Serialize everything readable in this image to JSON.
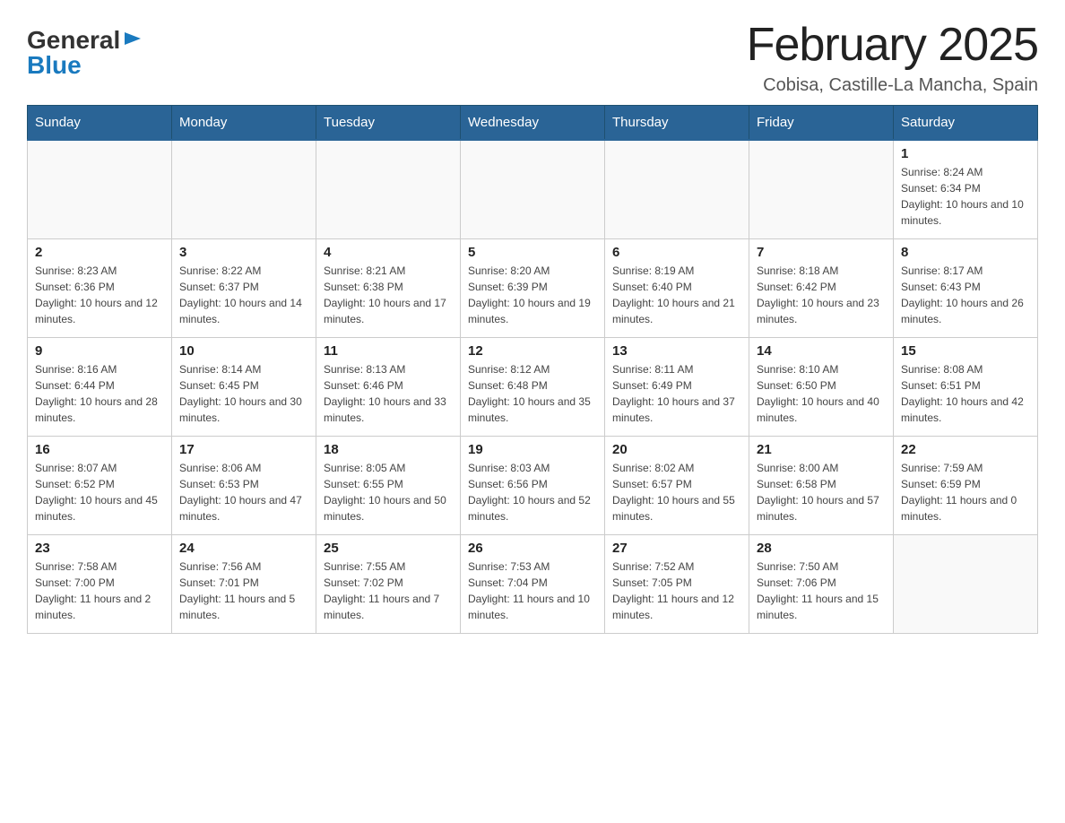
{
  "logo": {
    "general": "General",
    "blue": "Blue",
    "arrow_symbol": "▶"
  },
  "title": "February 2025",
  "subtitle": "Cobisa, Castille-La Mancha, Spain",
  "days_of_week": [
    "Sunday",
    "Monday",
    "Tuesday",
    "Wednesday",
    "Thursday",
    "Friday",
    "Saturday"
  ],
  "weeks": [
    [
      {
        "day": "",
        "info": ""
      },
      {
        "day": "",
        "info": ""
      },
      {
        "day": "",
        "info": ""
      },
      {
        "day": "",
        "info": ""
      },
      {
        "day": "",
        "info": ""
      },
      {
        "day": "",
        "info": ""
      },
      {
        "day": "1",
        "info": "Sunrise: 8:24 AM\nSunset: 6:34 PM\nDaylight: 10 hours and 10 minutes."
      }
    ],
    [
      {
        "day": "2",
        "info": "Sunrise: 8:23 AM\nSunset: 6:36 PM\nDaylight: 10 hours and 12 minutes."
      },
      {
        "day": "3",
        "info": "Sunrise: 8:22 AM\nSunset: 6:37 PM\nDaylight: 10 hours and 14 minutes."
      },
      {
        "day": "4",
        "info": "Sunrise: 8:21 AM\nSunset: 6:38 PM\nDaylight: 10 hours and 17 minutes."
      },
      {
        "day": "5",
        "info": "Sunrise: 8:20 AM\nSunset: 6:39 PM\nDaylight: 10 hours and 19 minutes."
      },
      {
        "day": "6",
        "info": "Sunrise: 8:19 AM\nSunset: 6:40 PM\nDaylight: 10 hours and 21 minutes."
      },
      {
        "day": "7",
        "info": "Sunrise: 8:18 AM\nSunset: 6:42 PM\nDaylight: 10 hours and 23 minutes."
      },
      {
        "day": "8",
        "info": "Sunrise: 8:17 AM\nSunset: 6:43 PM\nDaylight: 10 hours and 26 minutes."
      }
    ],
    [
      {
        "day": "9",
        "info": "Sunrise: 8:16 AM\nSunset: 6:44 PM\nDaylight: 10 hours and 28 minutes."
      },
      {
        "day": "10",
        "info": "Sunrise: 8:14 AM\nSunset: 6:45 PM\nDaylight: 10 hours and 30 minutes."
      },
      {
        "day": "11",
        "info": "Sunrise: 8:13 AM\nSunset: 6:46 PM\nDaylight: 10 hours and 33 minutes."
      },
      {
        "day": "12",
        "info": "Sunrise: 8:12 AM\nSunset: 6:48 PM\nDaylight: 10 hours and 35 minutes."
      },
      {
        "day": "13",
        "info": "Sunrise: 8:11 AM\nSunset: 6:49 PM\nDaylight: 10 hours and 37 minutes."
      },
      {
        "day": "14",
        "info": "Sunrise: 8:10 AM\nSunset: 6:50 PM\nDaylight: 10 hours and 40 minutes."
      },
      {
        "day": "15",
        "info": "Sunrise: 8:08 AM\nSunset: 6:51 PM\nDaylight: 10 hours and 42 minutes."
      }
    ],
    [
      {
        "day": "16",
        "info": "Sunrise: 8:07 AM\nSunset: 6:52 PM\nDaylight: 10 hours and 45 minutes."
      },
      {
        "day": "17",
        "info": "Sunrise: 8:06 AM\nSunset: 6:53 PM\nDaylight: 10 hours and 47 minutes."
      },
      {
        "day": "18",
        "info": "Sunrise: 8:05 AM\nSunset: 6:55 PM\nDaylight: 10 hours and 50 minutes."
      },
      {
        "day": "19",
        "info": "Sunrise: 8:03 AM\nSunset: 6:56 PM\nDaylight: 10 hours and 52 minutes."
      },
      {
        "day": "20",
        "info": "Sunrise: 8:02 AM\nSunset: 6:57 PM\nDaylight: 10 hours and 55 minutes."
      },
      {
        "day": "21",
        "info": "Sunrise: 8:00 AM\nSunset: 6:58 PM\nDaylight: 10 hours and 57 minutes."
      },
      {
        "day": "22",
        "info": "Sunrise: 7:59 AM\nSunset: 6:59 PM\nDaylight: 11 hours and 0 minutes."
      }
    ],
    [
      {
        "day": "23",
        "info": "Sunrise: 7:58 AM\nSunset: 7:00 PM\nDaylight: 11 hours and 2 minutes."
      },
      {
        "day": "24",
        "info": "Sunrise: 7:56 AM\nSunset: 7:01 PM\nDaylight: 11 hours and 5 minutes."
      },
      {
        "day": "25",
        "info": "Sunrise: 7:55 AM\nSunset: 7:02 PM\nDaylight: 11 hours and 7 minutes."
      },
      {
        "day": "26",
        "info": "Sunrise: 7:53 AM\nSunset: 7:04 PM\nDaylight: 11 hours and 10 minutes."
      },
      {
        "day": "27",
        "info": "Sunrise: 7:52 AM\nSunset: 7:05 PM\nDaylight: 11 hours and 12 minutes."
      },
      {
        "day": "28",
        "info": "Sunrise: 7:50 AM\nSunset: 7:06 PM\nDaylight: 11 hours and 15 minutes."
      },
      {
        "day": "",
        "info": ""
      }
    ]
  ]
}
